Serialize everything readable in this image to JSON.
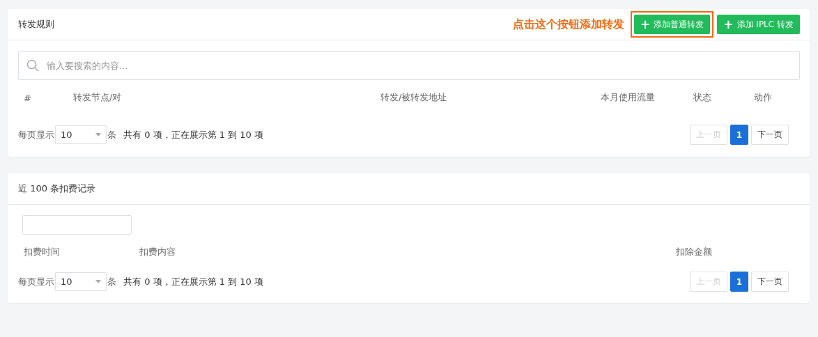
{
  "forward_rules": {
    "title": "转发规则",
    "annotation": "点击这个按钮添加转发",
    "buttons": [
      {
        "icon": "+",
        "label": "添加普通转发",
        "highlighted": true
      },
      {
        "icon": "+",
        "label": "添加 IPLC 转发",
        "highlighted": false
      }
    ],
    "search": {
      "placeholder": "输入要搜索的内容..."
    },
    "columns": [
      "#",
      "转发节点/对",
      "转发/被转发地址",
      "本月使用流量",
      "状态",
      "动作"
    ],
    "pager": {
      "per_page_label": "每页显示",
      "per_page": "10",
      "unit": "条",
      "summary": "共有 0 项，正在展示第 1 到 10 项",
      "prev": {
        "label": "上一页",
        "disabled": true
      },
      "pages": [
        {
          "label": "1",
          "selected": true
        }
      ],
      "next": {
        "label": "下一页",
        "disabled": false
      }
    }
  },
  "billing_records": {
    "title": "近 100 条扣费记录",
    "filter": {
      "kind": "text"
    },
    "columns": [
      "扣费时间",
      "扣费内容",
      "扣除金额"
    ],
    "pager": {
      "per_page_label": "每页显示",
      "per_page": "10",
      "unit": "条",
      "summary": "共有 0 项，正在展示第 1 到 10 项",
      "prev": {
        "label": "上一页",
        "disabled": true
      },
      "pages": [
        {
          "label": "1",
          "selected": true
        }
      ],
      "next": {
        "label": "下一页",
        "disabled": false
      }
    }
  }
}
